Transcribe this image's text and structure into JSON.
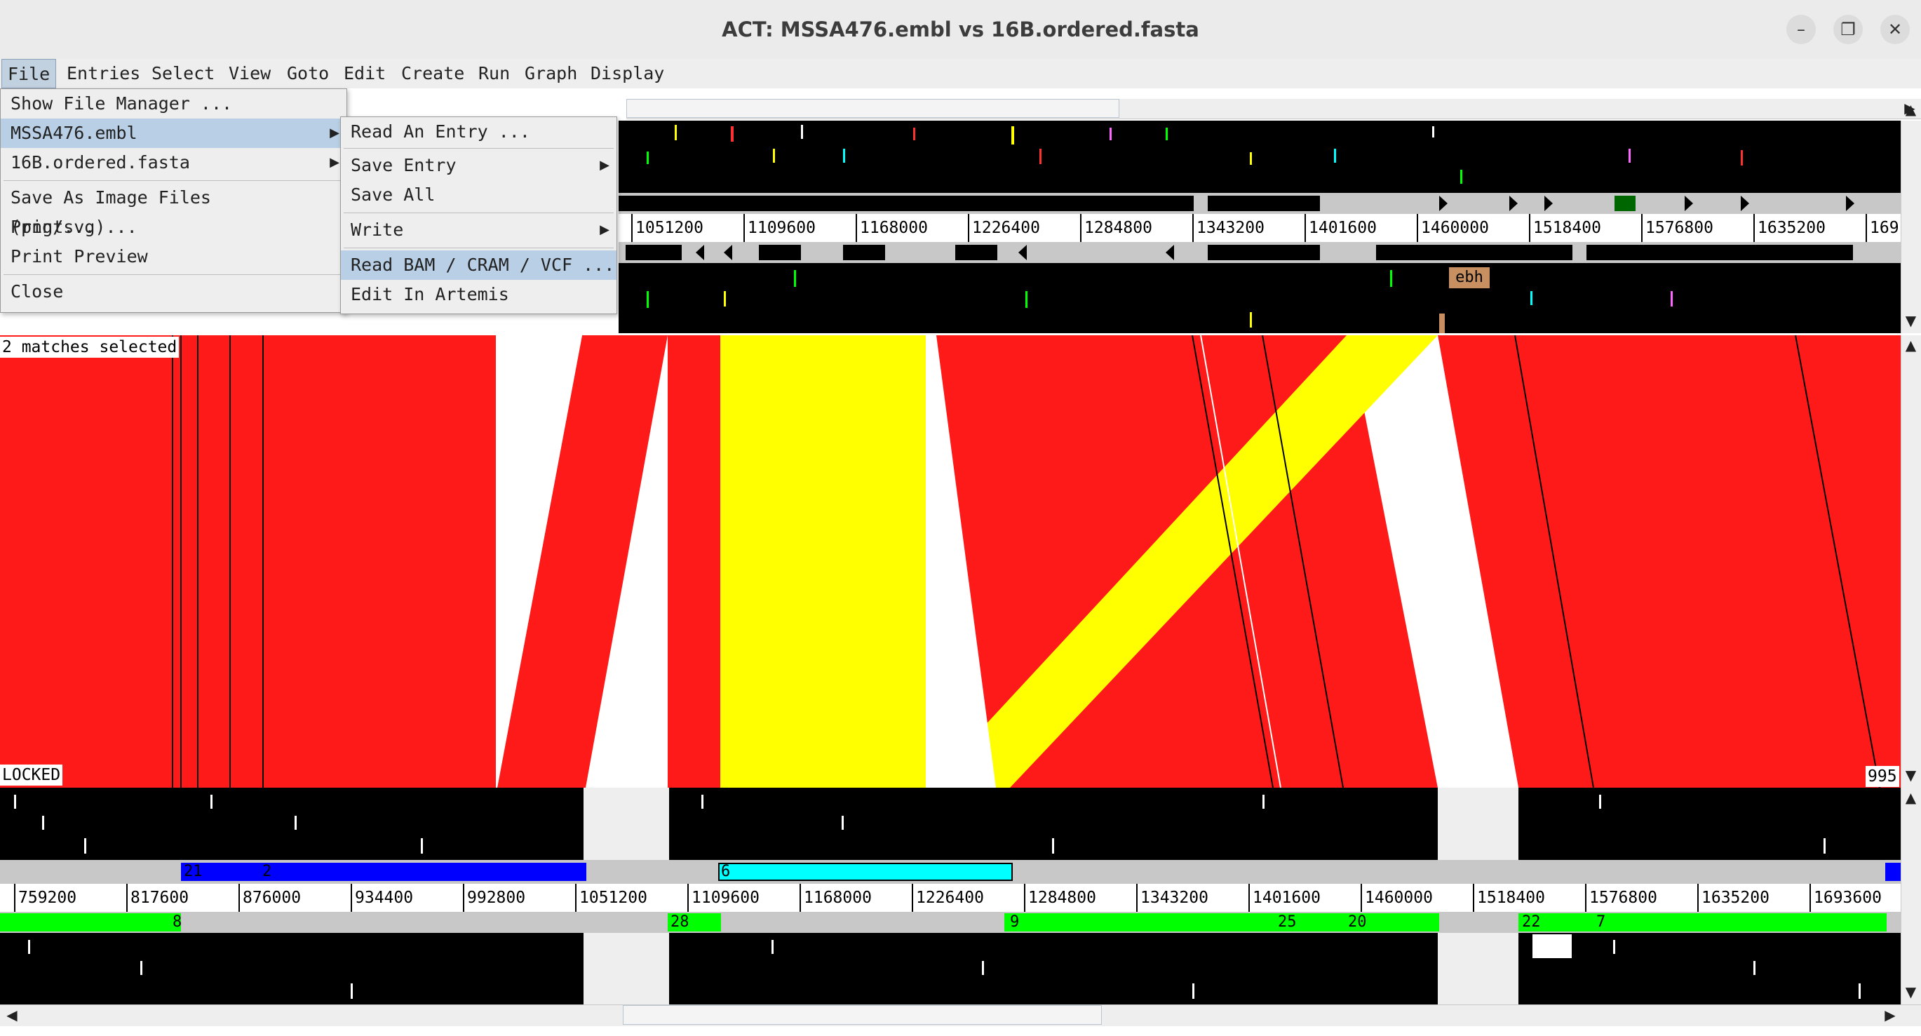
{
  "window": {
    "title": "ACT: MSSA476.embl vs 16B.ordered.fasta",
    "minimize": "–",
    "maximize": "❐",
    "close": "✕"
  },
  "menubar": [
    "File",
    "Entries",
    "Select",
    "View",
    "Goto",
    "Edit",
    "Create",
    "Run",
    "Graph",
    "Display"
  ],
  "file_menu": {
    "items": [
      "Show File Manager ...",
      "MSSA476.embl",
      "16B.ordered.fasta",
      "Save As Image Files (png/svg)...",
      "Print...",
      "Print Preview",
      "Close"
    ]
  },
  "entry_submenu": {
    "items": [
      "Read An Entry ...",
      "Save Entry",
      "Save All",
      "Write",
      "Read BAM / CRAM / VCF ...",
      "Edit In Artemis"
    ]
  },
  "top_ruler": [
    "1051200",
    "1109600",
    "1168000",
    "1226400",
    "1284800",
    "1343200",
    "1401600",
    "1460000",
    "1518400",
    "1576800",
    "1635200",
    "169"
  ],
  "bottom_ruler": [
    "759200",
    "817600",
    "876000",
    "934400",
    "992800",
    "1051200",
    "1109600",
    "1168000",
    "1226400",
    "1284800",
    "1343200",
    "1401600",
    "1460000",
    "1518400",
    "1576800",
    "1635200",
    "1693600"
  ],
  "comparison": {
    "selected_label": "2 matches selected",
    "locked_label": "LOCKED",
    "end_label": "995"
  },
  "feature_labels": {
    "ebh": "ebh",
    "c21": "21",
    "c2": "2",
    "c6": "6",
    "c8": "8",
    "c28": "28",
    "c9": "9",
    "c25": "25",
    "c20": "20",
    "c22": "22",
    "c7": "7"
  },
  "colors": {
    "match": "#ff1a1a",
    "inverted": "#ffff00",
    "selected_contig": "#00ffff",
    "contig": "#0000ff",
    "green_contig": "#00ff00"
  }
}
